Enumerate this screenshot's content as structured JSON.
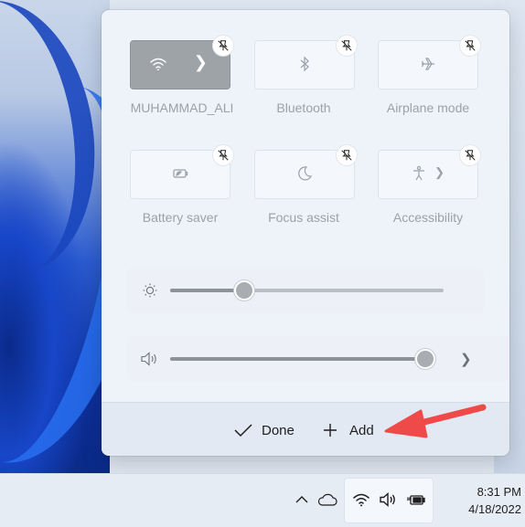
{
  "quick_settings": {
    "tiles": [
      {
        "label": "MUHAMMAD_ALI",
        "icon": "wifi-icon",
        "active": true,
        "has_chevron": true
      },
      {
        "label": "Bluetooth",
        "icon": "bluetooth-icon",
        "active": false,
        "has_chevron": false
      },
      {
        "label": "Airplane mode",
        "icon": "airplane-icon",
        "active": false,
        "has_chevron": false
      },
      {
        "label": "Battery saver",
        "icon": "battery-saver-icon",
        "active": false,
        "has_chevron": false
      },
      {
        "label": "Focus assist",
        "icon": "moon-icon",
        "active": false,
        "has_chevron": false
      },
      {
        "label": "Accessibility",
        "icon": "accessibility-icon",
        "active": false,
        "has_chevron": true
      }
    ],
    "brightness": {
      "icon": "brightness-icon",
      "level": 0.27
    },
    "volume": {
      "icon": "speaker-icon",
      "level": 0.97
    },
    "footer": {
      "done_label": "Done",
      "add_label": "Add"
    }
  },
  "taskbar": {
    "tray_icons": [
      "chevron-up-icon",
      "onedrive-cloud-icon",
      "wifi-icon",
      "speaker-icon",
      "battery-charging-icon"
    ],
    "time": "8:31 PM",
    "date": "4/18/2022"
  },
  "colors": {
    "annotation_arrow": "#ef4a4a",
    "panel_bg": "#eef3f9",
    "active_tile": "#9ea3a8"
  }
}
